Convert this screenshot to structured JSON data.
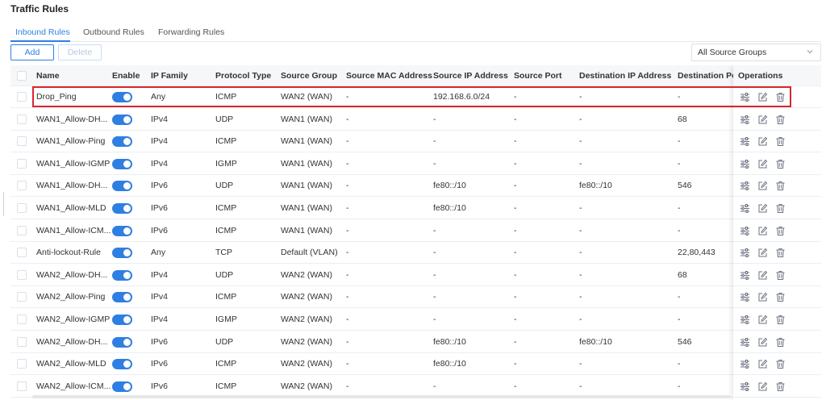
{
  "page": {
    "title": "Traffic Rules"
  },
  "tabs": [
    {
      "label": "Inbound Rules",
      "active": true
    },
    {
      "label": "Outbound Rules",
      "active": false
    },
    {
      "label": "Forwarding Rules",
      "active": false
    }
  ],
  "toolbar": {
    "add_label": "Add",
    "delete_label": "Delete",
    "source_group_filter": "All Source Groups"
  },
  "table": {
    "headers": {
      "name": "Name",
      "enable": "Enable",
      "ip_family": "IP Family",
      "protocol_type": "Protocol Type",
      "source_group": "Source Group",
      "source_mac": "Source MAC Address",
      "source_ip": "Source IP Address",
      "source_port": "Source Port",
      "dest_ip": "Destination IP Address",
      "dest_port": "Destination Po",
      "operations": "Operations"
    },
    "rows": [
      {
        "name": "Drop_Ping",
        "ip_family": "Any",
        "protocol": "ICMP",
        "source_group": "WAN2 (WAN)",
        "source_mac": "-",
        "source_ip": "192.168.6.0/24",
        "source_port": "-",
        "dest_ip": "-",
        "dest_port": "-"
      },
      {
        "name": "WAN1_Allow-DH...",
        "ip_family": "IPv4",
        "protocol": "UDP",
        "source_group": "WAN1 (WAN)",
        "source_mac": "-",
        "source_ip": "-",
        "source_port": "-",
        "dest_ip": "-",
        "dest_port": "68"
      },
      {
        "name": "WAN1_Allow-Ping",
        "ip_family": "IPv4",
        "protocol": "ICMP",
        "source_group": "WAN1 (WAN)",
        "source_mac": "-",
        "source_ip": "-",
        "source_port": "-",
        "dest_ip": "-",
        "dest_port": "-"
      },
      {
        "name": "WAN1_Allow-IGMP",
        "ip_family": "IPv4",
        "protocol": "IGMP",
        "source_group": "WAN1 (WAN)",
        "source_mac": "-",
        "source_ip": "-",
        "source_port": "-",
        "dest_ip": "-",
        "dest_port": "-"
      },
      {
        "name": "WAN1_Allow-DH...",
        "ip_family": "IPv6",
        "protocol": "UDP",
        "source_group": "WAN1 (WAN)",
        "source_mac": "-",
        "source_ip": "fe80::/10",
        "source_port": "-",
        "dest_ip": "fe80::/10",
        "dest_port": "546"
      },
      {
        "name": "WAN1_Allow-MLD",
        "ip_family": "IPv6",
        "protocol": "ICMP",
        "source_group": "WAN1 (WAN)",
        "source_mac": "-",
        "source_ip": "fe80::/10",
        "source_port": "-",
        "dest_ip": "-",
        "dest_port": "-"
      },
      {
        "name": "WAN1_Allow-ICM...",
        "ip_family": "IPv6",
        "protocol": "ICMP",
        "source_group": "WAN1 (WAN)",
        "source_mac": "-",
        "source_ip": "-",
        "source_port": "-",
        "dest_ip": "-",
        "dest_port": "-"
      },
      {
        "name": "Anti-lockout-Rule",
        "ip_family": "Any",
        "protocol": "TCP",
        "source_group": "Default (VLAN)",
        "source_mac": "-",
        "source_ip": "-",
        "source_port": "-",
        "dest_ip": "-",
        "dest_port": "22,80,443"
      },
      {
        "name": "WAN2_Allow-DH...",
        "ip_family": "IPv4",
        "protocol": "UDP",
        "source_group": "WAN2 (WAN)",
        "source_mac": "-",
        "source_ip": "-",
        "source_port": "-",
        "dest_ip": "-",
        "dest_port": "68"
      },
      {
        "name": "WAN2_Allow-Ping",
        "ip_family": "IPv4",
        "protocol": "ICMP",
        "source_group": "WAN2 (WAN)",
        "source_mac": "-",
        "source_ip": "-",
        "source_port": "-",
        "dest_ip": "-",
        "dest_port": "-"
      },
      {
        "name": "WAN2_Allow-IGMP",
        "ip_family": "IPv4",
        "protocol": "IGMP",
        "source_group": "WAN2 (WAN)",
        "source_mac": "-",
        "source_ip": "-",
        "source_port": "-",
        "dest_ip": "-",
        "dest_port": "-"
      },
      {
        "name": "WAN2_Allow-DH...",
        "ip_family": "IPv6",
        "protocol": "UDP",
        "source_group": "WAN2 (WAN)",
        "source_mac": "-",
        "source_ip": "fe80::/10",
        "source_port": "-",
        "dest_ip": "fe80::/10",
        "dest_port": "546"
      },
      {
        "name": "WAN2_Allow-MLD",
        "ip_family": "IPv6",
        "protocol": "ICMP",
        "source_group": "WAN2 (WAN)",
        "source_mac": "-",
        "source_ip": "fe80::/10",
        "source_port": "-",
        "dest_ip": "-",
        "dest_port": "-"
      },
      {
        "name": "WAN2_Allow-ICM...",
        "ip_family": "IPv6",
        "protocol": "ICMP",
        "source_group": "WAN2 (WAN)",
        "source_mac": "-",
        "source_ip": "-",
        "source_port": "-",
        "dest_ip": "-",
        "dest_port": "-"
      }
    ]
  },
  "colors": {
    "accent": "#2f7fe3",
    "highlight": "#d9262c",
    "header_bg": "#f6f7f9",
    "icon": "#6b7280"
  },
  "icons": {
    "operations": [
      "sliders-icon",
      "edit-icon",
      "trash-icon"
    ],
    "toggle": "toggle-switch"
  }
}
